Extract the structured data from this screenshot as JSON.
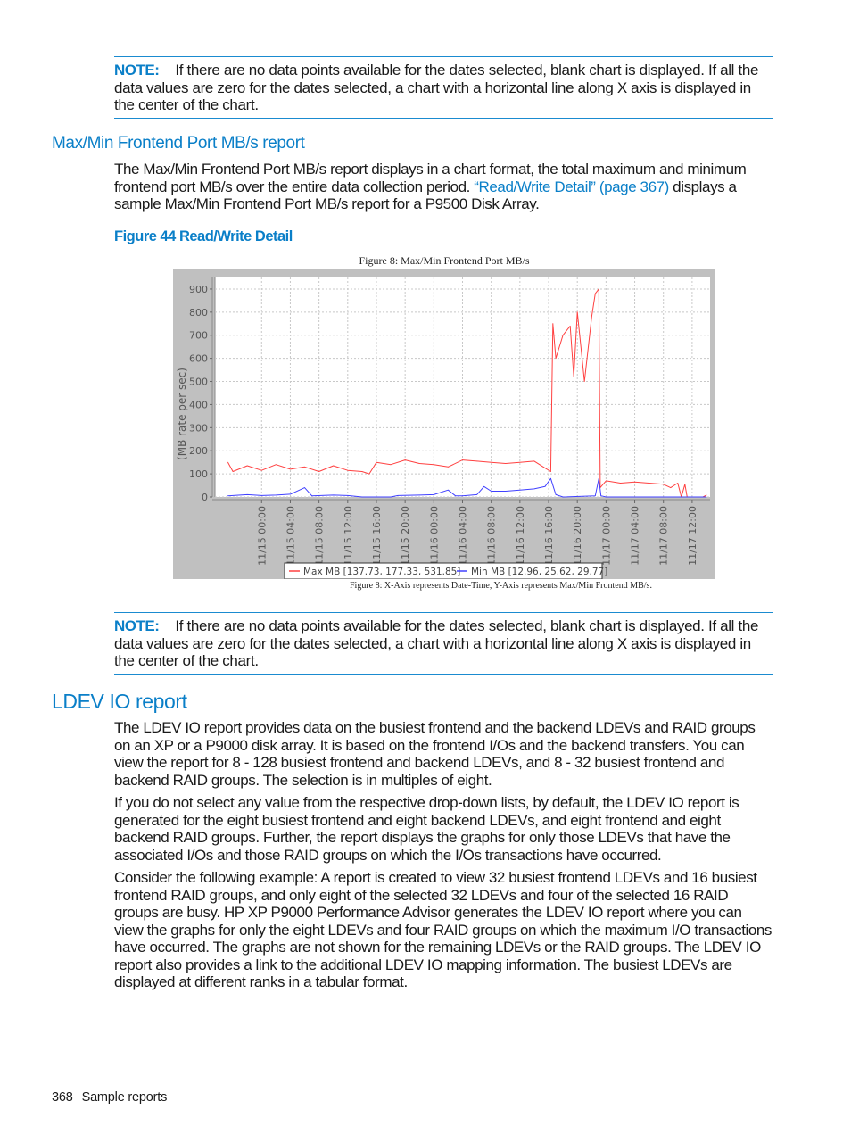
{
  "note1": {
    "label": "NOTE:",
    "text": "If there are no data points available for the dates selected, blank chart is displayed. If all the data values are zero for the dates selected, a chart with a horizontal line along X axis is displayed in the center of the chart."
  },
  "section_maxmin": {
    "heading": "Max/Min Frontend Port MB/s report",
    "para_before_link": "The Max/Min Frontend Port MB/s report displays in a chart format, the total maximum and minimum frontend port MB/s over the entire data collection period. ",
    "link_text": "“Read/Write Detail” (page 367)",
    "para_after_link": " displays a sample Max/Min Frontend Port MB/s report for a P9500 Disk Array.",
    "figure_caption": "Figure 44 Read/Write Detail"
  },
  "chart_data": {
    "type": "line",
    "title": "Figure 8: Max/Min Frontend Port MB/s",
    "footnote": "Figure 8: X-Axis represents Date-Time, Y-Axis represents Max/Min Frontend MB/s.",
    "xlabel": "",
    "ylabel": "(MB rate per sec)",
    "ylim": [
      0,
      950
    ],
    "yticks": [
      0,
      100,
      200,
      300,
      400,
      500,
      600,
      700,
      800,
      900
    ],
    "grid": true,
    "legend_position": "bottom",
    "x_tick_labels": [
      "11/15 00:00",
      "11/15 04:00",
      "11/15 08:00",
      "11/15 12:00",
      "11/15 16:00",
      "11/15 20:00",
      "11/16 00:00",
      "11/16 04:00",
      "11/16 08:00",
      "11/16 12:00",
      "11/16 16:00",
      "11/16 20:00",
      "11/17 00:00",
      "11/17 04:00",
      "11/17 08:00",
      "11/17 12:00"
    ],
    "x_range_hours": [
      -6.5,
      62.5
    ],
    "series": [
      {
        "name": "Max MB",
        "legend_label": "Max MB  [137.73, 177.33, 531.85]",
        "color": "#ff4040",
        "points": [
          [
            -4.7,
            150
          ],
          [
            -4,
            110
          ],
          [
            -2,
            135
          ],
          [
            0,
            115
          ],
          [
            2,
            140
          ],
          [
            4,
            120
          ],
          [
            6,
            130
          ],
          [
            8,
            110
          ],
          [
            10,
            135
          ],
          [
            12,
            115
          ],
          [
            14,
            110
          ],
          [
            15,
            100
          ],
          [
            16,
            150
          ],
          [
            18,
            140
          ],
          [
            20,
            160
          ],
          [
            22,
            145
          ],
          [
            24,
            140
          ],
          [
            26,
            130
          ],
          [
            28,
            160
          ],
          [
            30,
            155
          ],
          [
            32,
            150
          ],
          [
            34,
            145
          ],
          [
            36,
            150
          ],
          [
            38,
            155
          ],
          [
            39.5,
            125
          ],
          [
            40.3,
            110
          ],
          [
            40.6,
            750
          ],
          [
            41,
            600
          ],
          [
            42,
            700
          ],
          [
            43,
            740
          ],
          [
            43.5,
            520
          ],
          [
            44,
            800
          ],
          [
            45,
            500
          ],
          [
            46,
            780
          ],
          [
            46.5,
            880
          ],
          [
            47,
            900
          ],
          [
            47.2,
            40
          ],
          [
            48,
            70
          ],
          [
            50,
            60
          ],
          [
            52,
            65
          ],
          [
            54,
            60
          ],
          [
            56,
            55
          ],
          [
            57,
            40
          ],
          [
            58,
            60
          ],
          [
            58.5,
            0
          ],
          [
            59,
            55
          ],
          [
            59.3,
            0
          ],
          [
            61.5,
            0
          ],
          [
            62,
            8
          ]
        ]
      },
      {
        "name": "Min MB",
        "legend_label": "Min MB  [12.96, 25.62, 29.77]",
        "color": "#4040ff",
        "points": [
          [
            -4.7,
            5
          ],
          [
            -2,
            10
          ],
          [
            0,
            6
          ],
          [
            2,
            8
          ],
          [
            4,
            12
          ],
          [
            6,
            40
          ],
          [
            7,
            5
          ],
          [
            10,
            8
          ],
          [
            12,
            6
          ],
          [
            14,
            0
          ],
          [
            18,
            0
          ],
          [
            19,
            6
          ],
          [
            22,
            8
          ],
          [
            24,
            10
          ],
          [
            26,
            30
          ],
          [
            27,
            5
          ],
          [
            28,
            5
          ],
          [
            30,
            10
          ],
          [
            31,
            45
          ],
          [
            32,
            25
          ],
          [
            34,
            25
          ],
          [
            36,
            30
          ],
          [
            38,
            35
          ],
          [
            39.5,
            45
          ],
          [
            40.3,
            80
          ],
          [
            41,
            10
          ],
          [
            42,
            0
          ],
          [
            46.5,
            5
          ],
          [
            47,
            80
          ],
          [
            47.3,
            5
          ],
          [
            48,
            0
          ],
          [
            62,
            0
          ]
        ]
      }
    ]
  },
  "note2": {
    "label": "NOTE:",
    "text": "If there are no data points available for the dates selected, blank chart is displayed. If all the data values are zero for the dates selected, a chart with a horizontal line along X axis is displayed in the center of the chart."
  },
  "section_ldev": {
    "heading": "LDEV IO report",
    "paragraphs": [
      "The LDEV IO report provides data on the busiest frontend and the backend LDEVs and RAID groups on an XP or a P9000 disk array. It is based on the frontend I/Os and the backend transfers. You can view the report for 8 - 128 busiest frontend and backend LDEVs, and 8 - 32 busiest frontend and backend RAID groups. The selection is in multiples of eight.",
      "If you do not select any value from the respective drop-down lists, by default, the LDEV IO report is generated for the eight busiest frontend and eight backend LDEVs, and eight frontend and eight backend RAID groups. Further, the report displays the graphs for only those LDEVs that have the associated I/Os and those RAID groups on which the I/Os transactions have occurred.",
      "Consider the following example: A report is created to view 32 busiest frontend LDEVs and 16 busiest frontend RAID groups, and only eight of the selected 32 LDEVs and four of the selected 16 RAID groups are busy. HP XP P9000 Performance Advisor generates the LDEV IO report where you can view the graphs for only the eight LDEVs and four RAID groups on which the maximum I/O transactions have occurred. The graphs are not shown for the remaining LDEVs or the RAID groups. The LDEV IO report also provides a link to the additional LDEV IO mapping information. The busiest LDEVs are displayed at different ranks in a tabular format."
    ]
  },
  "footer": {
    "page_number": "368",
    "section": "Sample reports"
  }
}
